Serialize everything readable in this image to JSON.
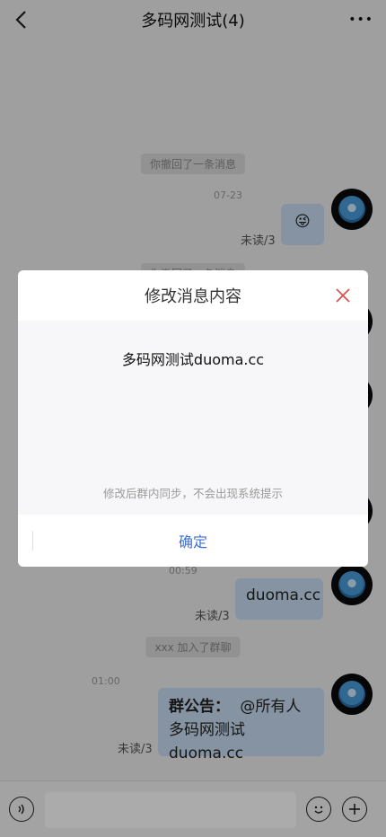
{
  "header": {
    "title": "多码网测试(4)",
    "more": "•••"
  },
  "messages": {
    "system_recall_1": "你撤回了一条消息",
    "time_1": "07-23",
    "emoji": "😜",
    "unread_1": "未读/3",
    "system_recall_2": "你撤回了一条消息",
    "time_2": "00:59",
    "bubble_2": "duoma.cc",
    "unread_2": "未读/3",
    "system_join": "xxx 加入了群聊",
    "time_3": "01:00",
    "notice_label": "群公告：",
    "notice_mention": "@所有人",
    "notice_text": "多码网测试duoma.cc",
    "unread_3": "未读/3"
  },
  "modal": {
    "title": "修改消息内容",
    "content": "多码网测试duoma.cc",
    "hint": "修改后群内同步，不会出现系统提示",
    "confirm": "确定"
  },
  "colors": {
    "accent": "#3d6fd2",
    "close": "#d9534f",
    "bubble": "#c8dcf2"
  },
  "icons": [
    "back-arrow-icon",
    "more-icon",
    "voice-icon",
    "emoji-icon",
    "plus-icon",
    "close-icon"
  ]
}
